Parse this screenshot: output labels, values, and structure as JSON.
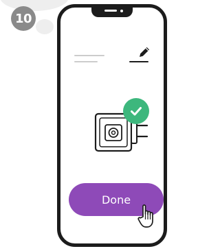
{
  "step": {
    "number": "10"
  },
  "phone": {
    "done_button": {
      "label": "Done",
      "color": "#8e4ab8"
    },
    "status_icon": "checkmark-circle-icon",
    "status_color": "#3db77d",
    "edit_icon": "pencil-icon",
    "device_icon": "smart-plug-icon",
    "cursor_icon": "hand-pointer-icon"
  }
}
